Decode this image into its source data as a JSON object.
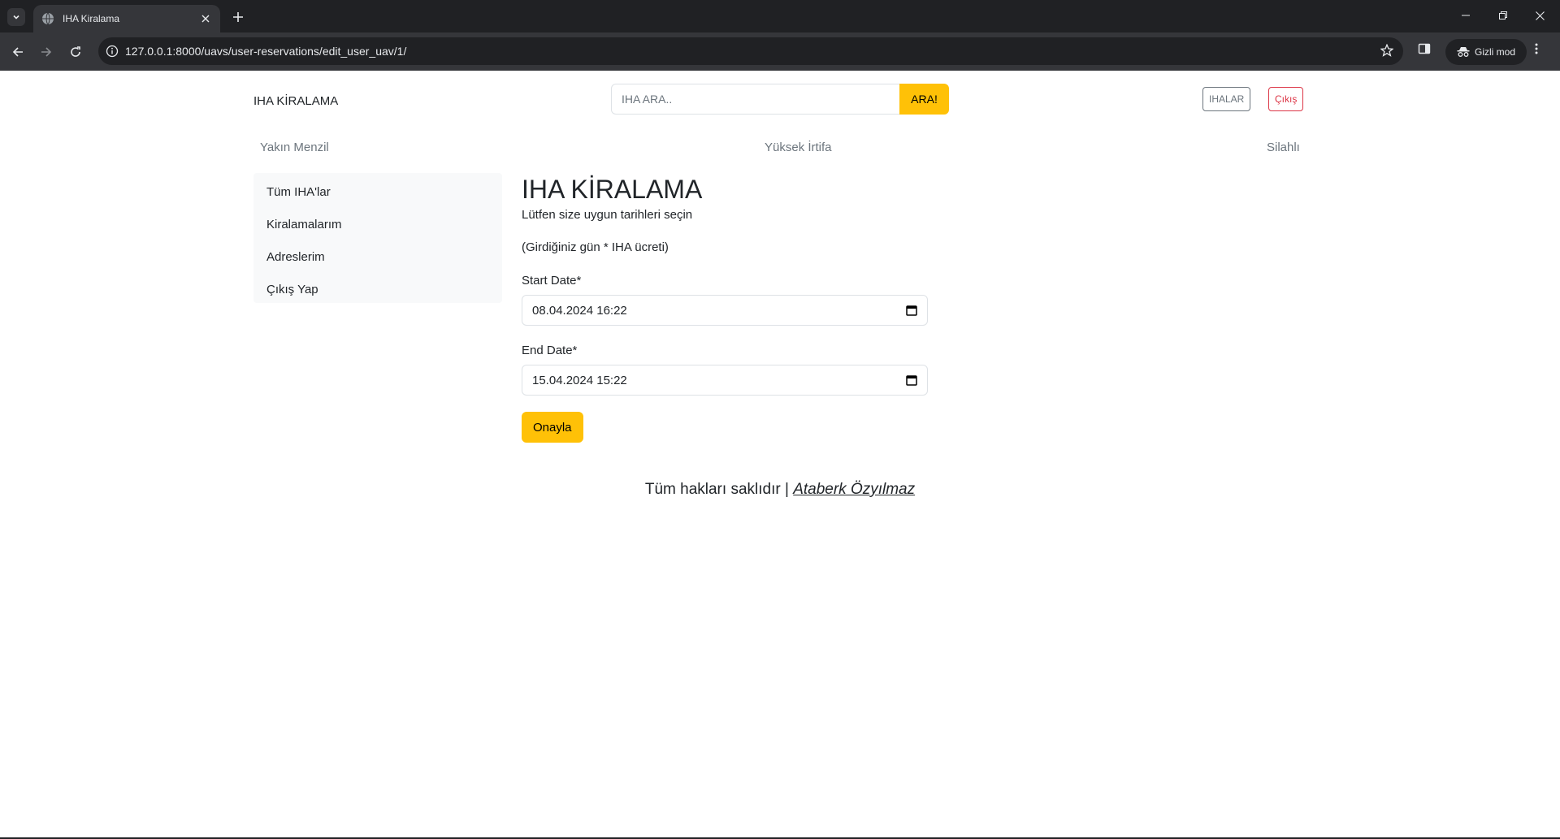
{
  "browser": {
    "tab_title": "IHA Kiralama",
    "url": "127.0.0.1:8000/uavs/user-reservations/edit_user_uav/1/",
    "incognito_label": "Gizli mod"
  },
  "header": {
    "brand": "IHA KİRALAMA",
    "search_placeholder": "IHA ARA..",
    "search_button": "ARA!",
    "ihalar_button": "IHALAR",
    "logout_button": "Çıkış"
  },
  "categories": [
    "Yakın Menzil",
    "Yüksek İrtifa",
    "Silahlı"
  ],
  "sidebar": {
    "items": [
      {
        "label": "Tüm IHA'lar"
      },
      {
        "label": "Kiralamalarım"
      },
      {
        "label": "Adreslerim"
      },
      {
        "label": "Çıkış Yap"
      }
    ]
  },
  "main": {
    "title": "IHA KİRALAMA",
    "subtitle": "Lütfen size uygun tarihleri seçin",
    "note": "(Girdiğiniz gün * IHA ücreti)",
    "start_label": "Start Date*",
    "start_value": "08.04.2024 16:22",
    "end_label": "End Date*",
    "end_value": "15.04.2024 15:22",
    "confirm_button": "Onayla"
  },
  "footer": {
    "text": "Tüm hakları saklıdır |",
    "author": "Ataberk Özyılmaz"
  },
  "colors": {
    "accent": "#ffc107",
    "danger": "#dc3545",
    "secondary": "#6c757d"
  }
}
